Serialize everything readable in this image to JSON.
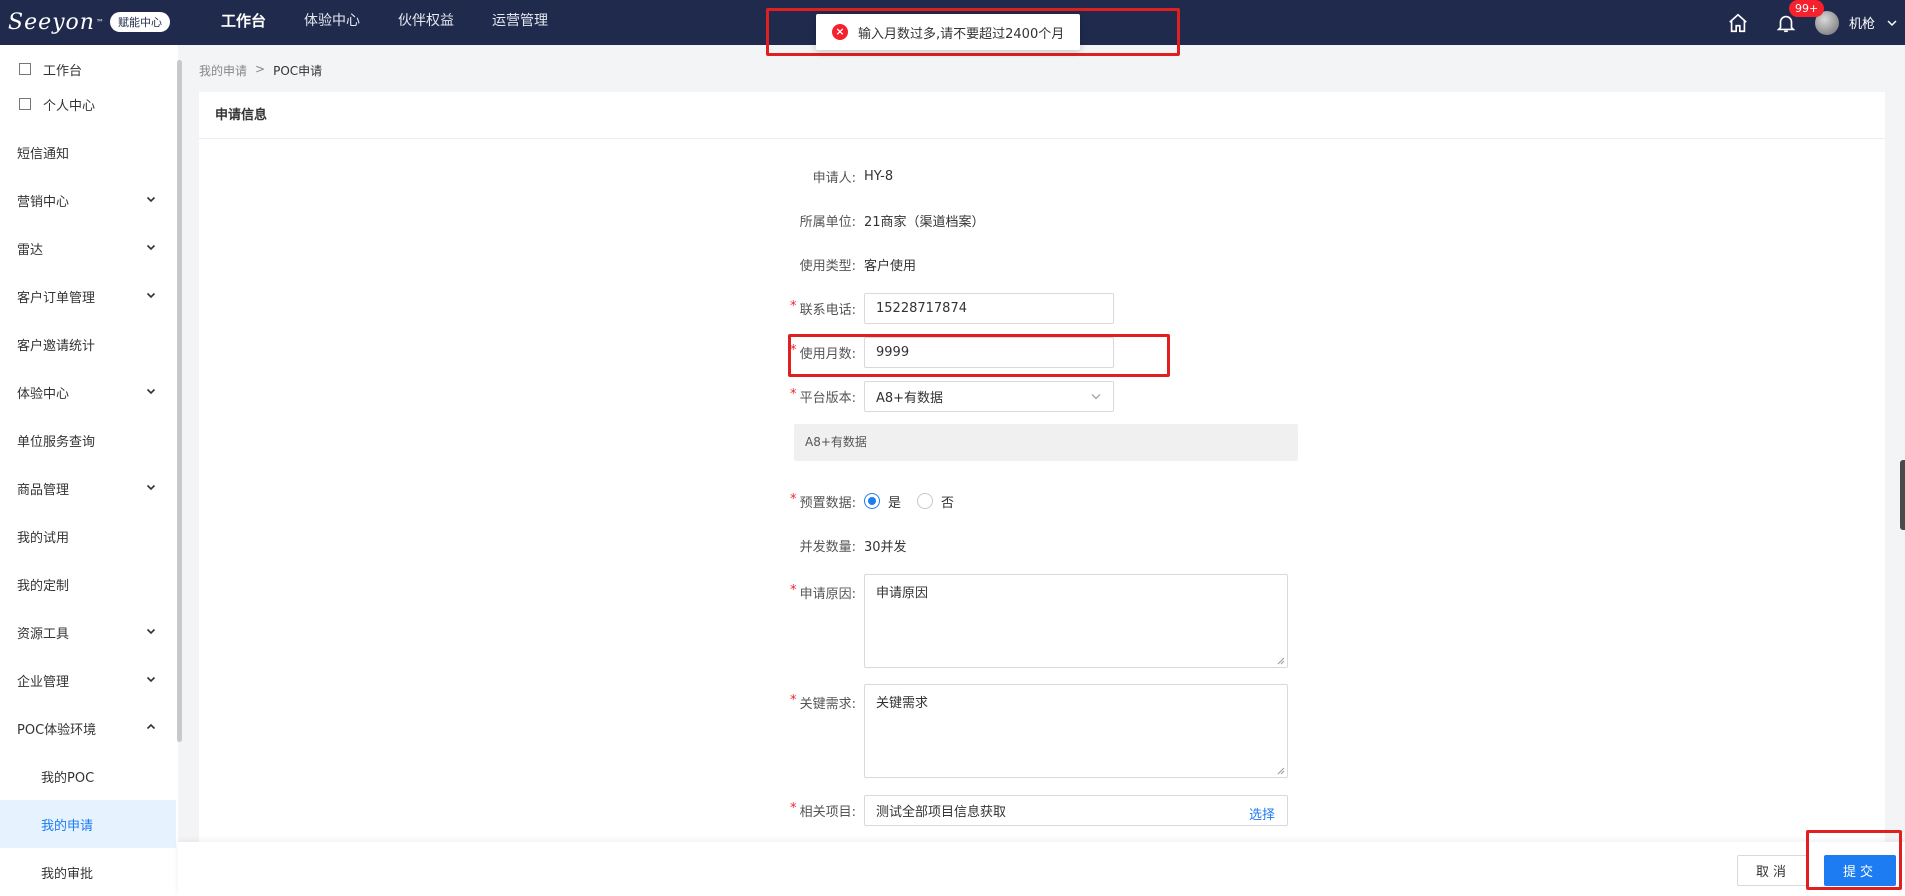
{
  "brand": {
    "logo": "Seeyon",
    "tm": "™",
    "badge": "赋能中心"
  },
  "topnav": [
    "工作台",
    "体验中心",
    "伙伴权益",
    "运营管理"
  ],
  "topright": {
    "badge": "99+",
    "username": "机枪"
  },
  "toast": {
    "message": "输入月数过多,请不要超过2400个月"
  },
  "sidebar": {
    "items": [
      {
        "label": "工作台"
      },
      {
        "label": "个人中心"
      },
      {
        "label": "短信通知"
      },
      {
        "label": "营销中心"
      },
      {
        "label": "雷达"
      },
      {
        "label": "客户订单管理"
      },
      {
        "label": "客户邀请统计"
      },
      {
        "label": "体验中心"
      },
      {
        "label": "单位服务查询"
      },
      {
        "label": "商品管理"
      },
      {
        "label": "我的试用"
      },
      {
        "label": "我的定制"
      },
      {
        "label": "资源工具"
      },
      {
        "label": "企业管理"
      },
      {
        "label": "POC体验环境"
      },
      {
        "label": "我的POC"
      },
      {
        "label": "我的申请"
      },
      {
        "label": "我的审批"
      }
    ]
  },
  "breadcrumb": {
    "parent": "我的申请",
    "sep": ">",
    "current": "POC申请"
  },
  "panel": {
    "title": "申请信息"
  },
  "form": {
    "applicant": {
      "label": "申请人:",
      "value": "HY-8"
    },
    "unit": {
      "label": "所属单位:",
      "value": "21商家（渠道档案）"
    },
    "usage_type": {
      "label": "使用类型:",
      "value": "客户使用"
    },
    "phone": {
      "label": "联系电话:",
      "value": "15228717874"
    },
    "months": {
      "label": "使用月数:",
      "value": "9999"
    },
    "platform": {
      "label": "平台版本:",
      "value": "A8+有数据",
      "hint": "A8+有数据"
    },
    "preset": {
      "label": "预置数据:",
      "yes": "是",
      "no": "否"
    },
    "concurrency": {
      "label": "并发数量:",
      "value": "30并发"
    },
    "reason": {
      "label": "申请原因:",
      "value": "申请原因"
    },
    "requirement": {
      "label": "关键需求:",
      "value": "关键需求"
    },
    "project": {
      "label": "相关项目:",
      "value": "测试全部项目信息获取",
      "action": "选择"
    },
    "required_mark": "*"
  },
  "footer": {
    "cancel": "取消",
    "submit": "提交"
  }
}
